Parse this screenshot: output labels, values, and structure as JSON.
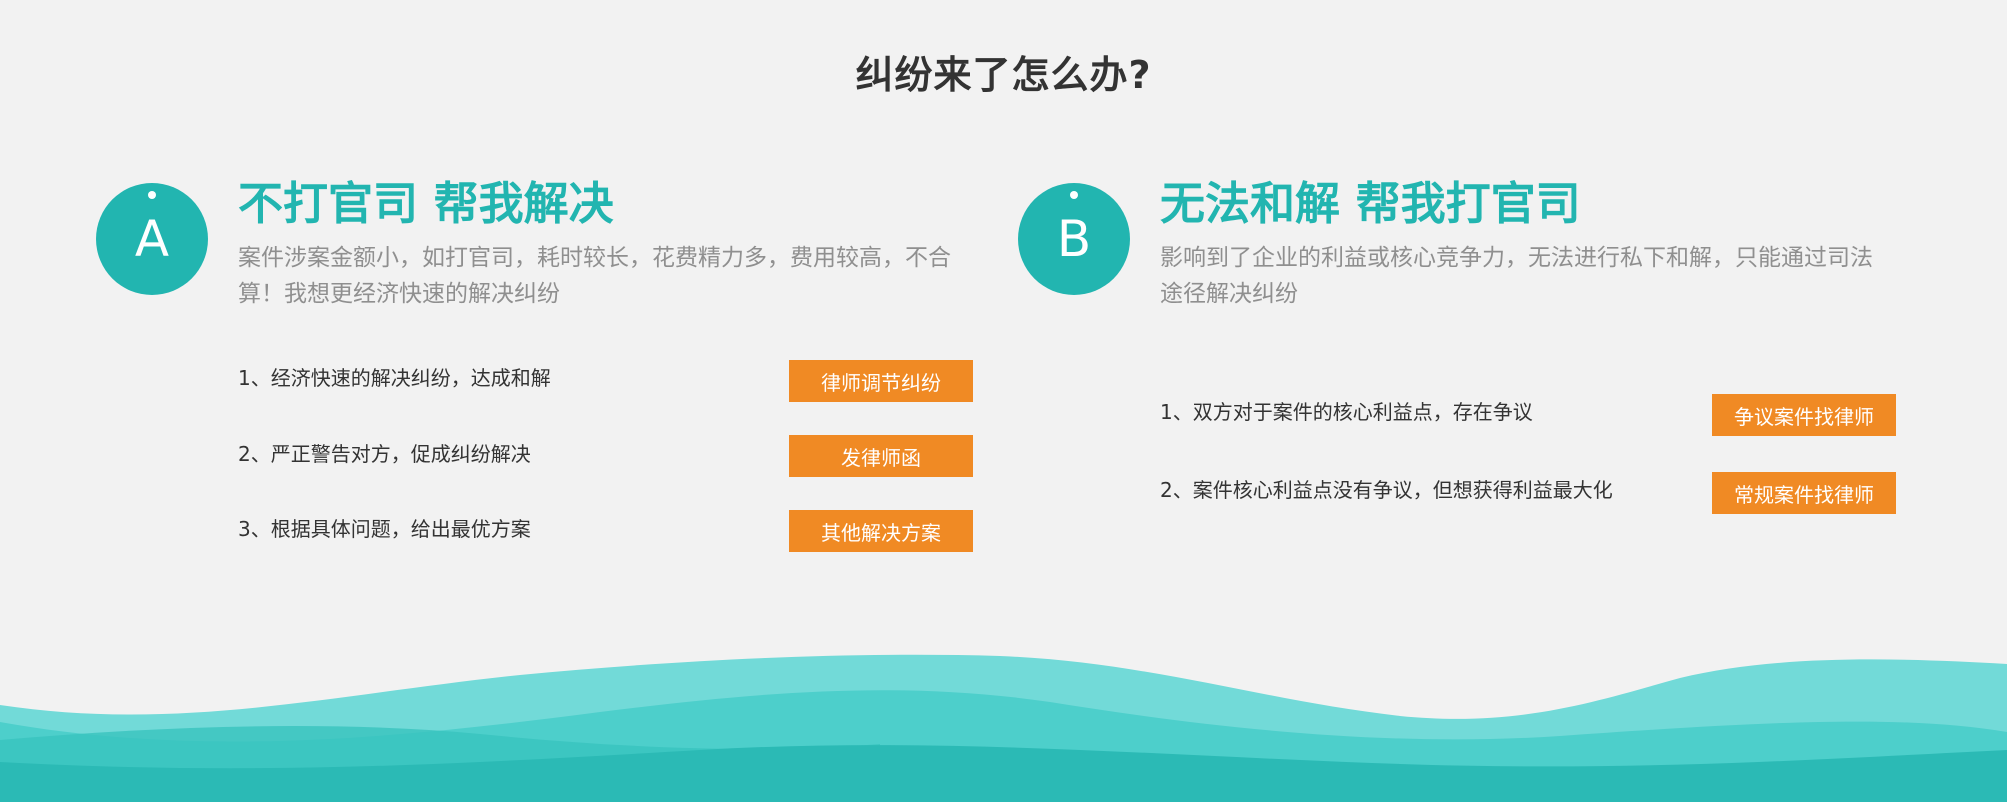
{
  "page": {
    "title": "纠纷来了怎么办?"
  },
  "colors": {
    "teal": "#22b5b0",
    "orange": "#f08a24",
    "text_dark": "#333333",
    "text_gray": "#8f8f8f"
  },
  "options": [
    {
      "letter": "A",
      "heading": "不打官司 帮我解决",
      "description": "案件涉案金额小，如打官司，耗时较长，花费精力多，费用较高，不合算！我想更经济快速的解决纠纷",
      "items": [
        {
          "text": "1、经济快速的解决纠纷，达成和解",
          "button": "律师调节纠纷"
        },
        {
          "text": "2、严正警告对方，促成纠纷解决",
          "button": "发律师函"
        },
        {
          "text": "3、根据具体问题，给出最优方案",
          "button": "其他解决方案"
        }
      ]
    },
    {
      "letter": "B",
      "heading": "无法和解 帮我打官司",
      "description": "影响到了企业的利益或核心竞争力，无法进行私下和解，只能通过司法途径解决纠纷",
      "items": [
        {
          "text": "1、双方对于案件的核心利益点，存在争议",
          "button": "争议案件找律师"
        },
        {
          "text": "2、案件核心利益点没有争议，但想获得利益最大化",
          "button": "常规案件找律师"
        }
      ]
    }
  ]
}
